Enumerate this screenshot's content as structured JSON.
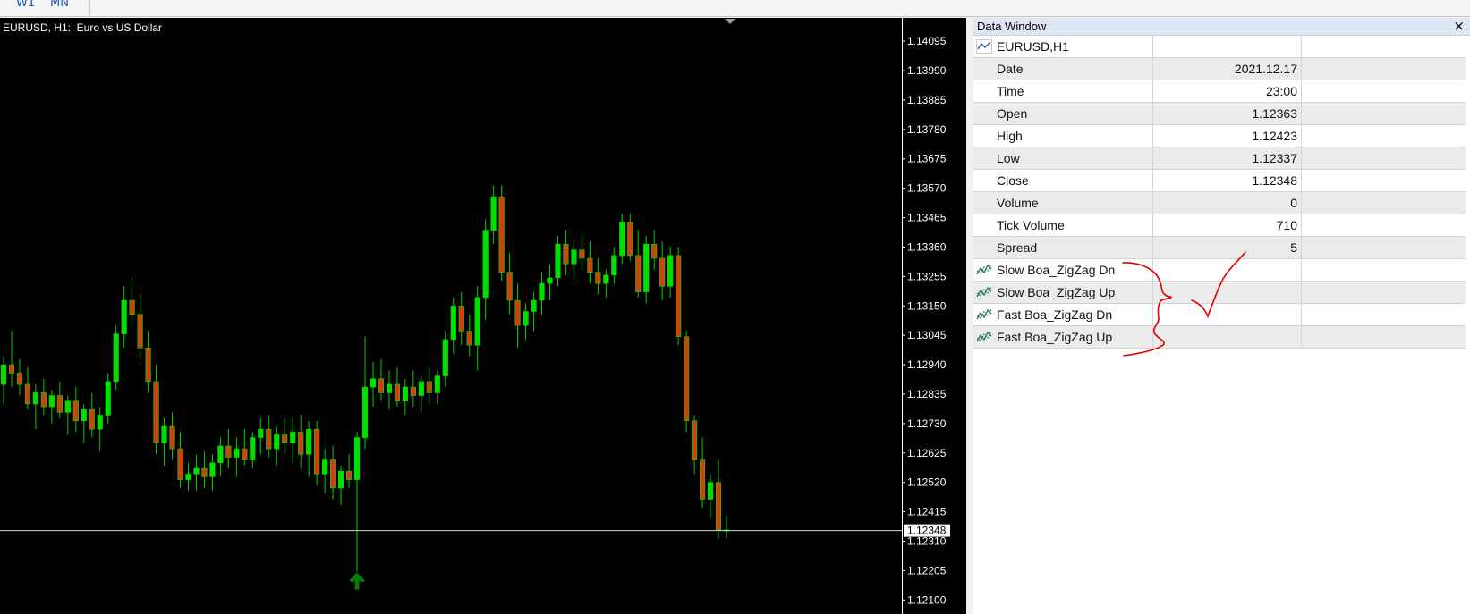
{
  "timeframe_tabs": [
    "W1",
    "MN"
  ],
  "chart": {
    "title": "EURUSD, H1:  Euro vs US Dollar",
    "current_price_label": "1.12348",
    "colors": {
      "background": "#000000",
      "bull": "#00e000",
      "bear": "#d04010",
      "wick": "#00d000",
      "price_line": "#d8d8d8",
      "arrow": "#0a7a0a"
    }
  },
  "chart_data": {
    "type": "candlestick",
    "title": "EURUSD, H1:  Euro vs US Dollar",
    "price_scale": [
      "1.14095",
      "1.13990",
      "1.13885",
      "1.13780",
      "1.13675",
      "1.13570",
      "1.13465",
      "1.13360",
      "1.13255",
      "1.13150",
      "1.13045",
      "1.12940",
      "1.12835",
      "1.12730",
      "1.12625",
      "1.12520",
      "1.12415",
      "1.12310",
      "1.12205",
      "1.12100"
    ],
    "ylim": [
      1.1205,
      1.1414
    ],
    "current_price": 1.12348,
    "candles": [
      [
        1.1287,
        1.1297,
        1.128,
        1.1294
      ],
      [
        1.1294,
        1.1306,
        1.1286,
        1.1291
      ],
      [
        1.1291,
        1.1296,
        1.1283,
        1.1287
      ],
      [
        1.1287,
        1.1293,
        1.1278,
        1.128
      ],
      [
        1.128,
        1.1287,
        1.1271,
        1.1284
      ],
      [
        1.1284,
        1.1289,
        1.1276,
        1.1279
      ],
      [
        1.1279,
        1.1285,
        1.1273,
        1.1283
      ],
      [
        1.1283,
        1.1288,
        1.1275,
        1.1277
      ],
      [
        1.1277,
        1.1283,
        1.1269,
        1.1281
      ],
      [
        1.1281,
        1.1286,
        1.127,
        1.1274
      ],
      [
        1.1274,
        1.128,
        1.1266,
        1.1278
      ],
      [
        1.1278,
        1.1284,
        1.1268,
        1.1271
      ],
      [
        1.1271,
        1.1279,
        1.1263,
        1.1276
      ],
      [
        1.1276,
        1.1291,
        1.1273,
        1.1288
      ],
      [
        1.1288,
        1.1308,
        1.1285,
        1.1305
      ],
      [
        1.1305,
        1.1322,
        1.13,
        1.1317
      ],
      [
        1.1317,
        1.1325,
        1.1308,
        1.1312
      ],
      [
        1.1312,
        1.1319,
        1.1296,
        1.13
      ],
      [
        1.13,
        1.1306,
        1.1284,
        1.1288
      ],
      [
        1.1288,
        1.1294,
        1.1262,
        1.1266
      ],
      [
        1.1266,
        1.1275,
        1.1258,
        1.1272
      ],
      [
        1.1272,
        1.1277,
        1.126,
        1.1264
      ],
      [
        1.1264,
        1.127,
        1.125,
        1.1253
      ],
      [
        1.1253,
        1.1259,
        1.1249,
        1.1255
      ],
      [
        1.1255,
        1.1262,
        1.1249,
        1.1257
      ],
      [
        1.1257,
        1.1263,
        1.125,
        1.1254
      ],
      [
        1.1254,
        1.1262,
        1.1249,
        1.1259
      ],
      [
        1.1259,
        1.1268,
        1.1254,
        1.1265
      ],
      [
        1.1265,
        1.1271,
        1.1257,
        1.1261
      ],
      [
        1.1261,
        1.1268,
        1.1254,
        1.1264
      ],
      [
        1.1264,
        1.1271,
        1.1258,
        1.126
      ],
      [
        1.126,
        1.127,
        1.1257,
        1.1268
      ],
      [
        1.1268,
        1.1275,
        1.1262,
        1.1271
      ],
      [
        1.1271,
        1.1276,
        1.1261,
        1.1264
      ],
      [
        1.1264,
        1.1272,
        1.1258,
        1.1269
      ],
      [
        1.1269,
        1.1275,
        1.1262,
        1.1266
      ],
      [
        1.1266,
        1.1275,
        1.1259,
        1.127
      ],
      [
        1.127,
        1.1276,
        1.1257,
        1.1262
      ],
      [
        1.1262,
        1.1274,
        1.1254,
        1.1271
      ],
      [
        1.1271,
        1.1274,
        1.1251,
        1.1255
      ],
      [
        1.1255,
        1.1264,
        1.1248,
        1.126
      ],
      [
        1.126,
        1.1265,
        1.1246,
        1.125
      ],
      [
        1.125,
        1.1258,
        1.1244,
        1.1256
      ],
      [
        1.1256,
        1.1262,
        1.125,
        1.1253
      ],
      [
        1.1253,
        1.127,
        1.1231,
        1.1268
      ],
      [
        1.1268,
        1.1304,
        1.1264,
        1.1286
      ],
      [
        1.1286,
        1.1295,
        1.1279,
        1.1289
      ],
      [
        1.1289,
        1.1296,
        1.1281,
        1.1284
      ],
      [
        1.1284,
        1.1292,
        1.1278,
        1.1287
      ],
      [
        1.1287,
        1.1293,
        1.1279,
        1.1281
      ],
      [
        1.1281,
        1.1289,
        1.1276,
        1.1286
      ],
      [
        1.1286,
        1.1292,
        1.1279,
        1.1283
      ],
      [
        1.1283,
        1.129,
        1.1277,
        1.1288
      ],
      [
        1.1288,
        1.1293,
        1.128,
        1.1284
      ],
      [
        1.1284,
        1.1292,
        1.128,
        1.129
      ],
      [
        1.129,
        1.1306,
        1.1286,
        1.1303
      ],
      [
        1.1303,
        1.1318,
        1.1298,
        1.1315
      ],
      [
        1.1315,
        1.132,
        1.1301,
        1.1306
      ],
      [
        1.1306,
        1.1312,
        1.1297,
        1.1301
      ],
      [
        1.1301,
        1.1322,
        1.1292,
        1.1318
      ],
      [
        1.1318,
        1.1346,
        1.131,
        1.1342
      ],
      [
        1.1342,
        1.1358,
        1.1337,
        1.1354
      ],
      [
        1.1354,
        1.1358,
        1.1324,
        1.1327
      ],
      [
        1.1327,
        1.1334,
        1.1312,
        1.1317
      ],
      [
        1.1317,
        1.1323,
        1.13,
        1.1308
      ],
      [
        1.1308,
        1.1316,
        1.1303,
        1.1313
      ],
      [
        1.1313,
        1.132,
        1.1306,
        1.1317
      ],
      [
        1.1317,
        1.1327,
        1.1312,
        1.1323
      ],
      [
        1.1323,
        1.133,
        1.1317,
        1.1325
      ],
      [
        1.1325,
        1.134,
        1.1322,
        1.1337
      ],
      [
        1.1337,
        1.1342,
        1.1326,
        1.133
      ],
      [
        1.133,
        1.1339,
        1.1324,
        1.1335
      ],
      [
        1.1335,
        1.1341,
        1.1328,
        1.1332
      ],
      [
        1.1332,
        1.1338,
        1.1323,
        1.1327
      ],
      [
        1.1327,
        1.1332,
        1.1319,
        1.1323
      ],
      [
        1.1323,
        1.1328,
        1.1318,
        1.1326
      ],
      [
        1.1326,
        1.1336,
        1.1323,
        1.1333
      ],
      [
        1.1333,
        1.1348,
        1.133,
        1.1345
      ],
      [
        1.1345,
        1.1348,
        1.1331,
        1.1333
      ],
      [
        1.1333,
        1.1342,
        1.1318,
        1.132
      ],
      [
        1.132,
        1.134,
        1.1316,
        1.1337
      ],
      [
        1.1337,
        1.1342,
        1.1328,
        1.1332
      ],
      [
        1.1332,
        1.1338,
        1.1317,
        1.1322
      ],
      [
        1.1322,
        1.1336,
        1.1318,
        1.1333
      ],
      [
        1.1333,
        1.1336,
        1.1301,
        1.1304
      ],
      [
        1.1304,
        1.1306,
        1.127,
        1.1274
      ],
      [
        1.1274,
        1.1276,
        1.1255,
        1.126
      ],
      [
        1.126,
        1.1268,
        1.1243,
        1.1246
      ],
      [
        1.1246,
        1.1255,
        1.1239,
        1.1252
      ],
      [
        1.1252,
        1.126,
        1.1232,
        1.1235
      ],
      [
        1.1235,
        1.124,
        1.1232,
        1.1235
      ]
    ],
    "buy_arrow_candle_index": 44
  },
  "data_window": {
    "title": "Data Window",
    "close_glyph": "×",
    "symbol_row": "EURUSD,H1",
    "rows": [
      {
        "label": "Date",
        "value": "2021.12.17"
      },
      {
        "label": "Time",
        "value": "23:00"
      },
      {
        "label": "Open",
        "value": "1.12363"
      },
      {
        "label": "High",
        "value": "1.12423"
      },
      {
        "label": "Low",
        "value": "1.12337"
      },
      {
        "label": "Close",
        "value": "1.12348"
      },
      {
        "label": "Volume",
        "value": "0"
      },
      {
        "label": "Tick Volume",
        "value": "710"
      },
      {
        "label": "Spread",
        "value": "5"
      }
    ],
    "indicators": [
      {
        "label": "Slow Boa_ZigZag Dn",
        "value": ""
      },
      {
        "label": "Slow Boa_ZigZag Up",
        "value": ""
      },
      {
        "label": "Fast Boa_ZigZag Dn",
        "value": ""
      },
      {
        "label": "Fast Boa_ZigZag Up",
        "value": ""
      }
    ]
  },
  "icons": {
    "symbol_row": "line-chart-icon",
    "indicator_row": "zigzag-indicator-icon",
    "chart_marker": "buy-arrow-icon"
  },
  "annotation_color": "#e00000"
}
